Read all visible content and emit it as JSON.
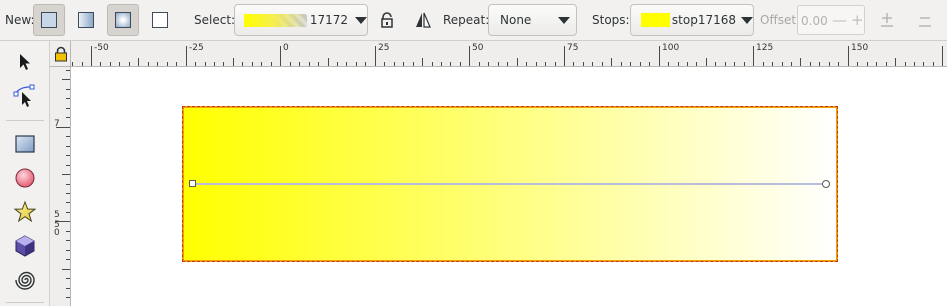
{
  "toolbar": {
    "new_label": "New:",
    "select_label": "Select:",
    "select_value": "17172",
    "repeat_label": "Repeat:",
    "repeat_value": "None",
    "stops_label": "Stops:",
    "stop_value": "stop17168",
    "offset_label": "Offset:",
    "offset_value": "0.00",
    "offset_minus": "—",
    "offset_plus": "+",
    "stop_color": "#ffff00"
  },
  "ruler": {
    "h_labels": [
      "-50",
      "-25",
      "0",
      "25",
      "50",
      "75",
      "100",
      "125",
      "150"
    ],
    "v_labels": [
      "7",
      "5",
      "5",
      "0"
    ]
  },
  "tools": [
    {
      "name": "selector-tool",
      "icon": "arrow-icon"
    },
    {
      "name": "node-tool",
      "icon": "node-arrow-icon"
    },
    {
      "name": "rectangle-tool",
      "icon": "rectangle-icon"
    },
    {
      "name": "ellipse-tool",
      "icon": "circle-icon"
    },
    {
      "name": "star-tool",
      "icon": "star-icon"
    },
    {
      "name": "3d-box-tool",
      "icon": "cube-icon"
    },
    {
      "name": "spiral-tool",
      "icon": "spiral-icon"
    }
  ],
  "canvas": {
    "gradient_start": "#ffff00",
    "gradient_end": "#ffffff",
    "selection_color": "#f0a000"
  }
}
